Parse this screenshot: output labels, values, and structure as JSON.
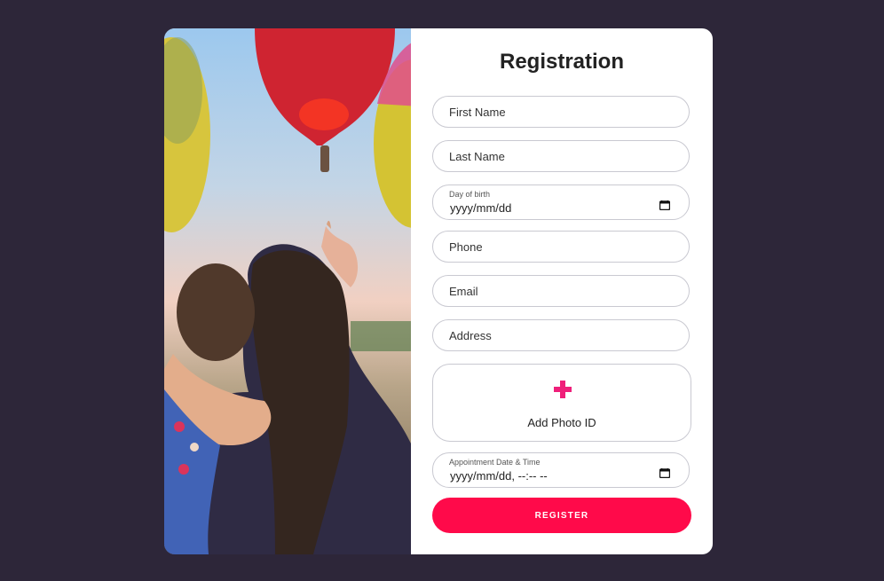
{
  "form": {
    "title": "Registration",
    "first_name_placeholder": "First Name",
    "last_name_placeholder": "Last Name",
    "dob_label": "Day of birth",
    "dob_value": "yyyy/mm/dd",
    "phone_placeholder": "Phone",
    "email_placeholder": "Email",
    "address_placeholder": "Address",
    "photo_id_label": "Add Photo ID",
    "appointment_label": "Appointment Date & Time",
    "appointment_value": "yyyy/mm/dd, --:-- --",
    "register_label": "REGISTER"
  },
  "icons": {
    "calendar": "calendar-icon",
    "plus": "plus-icon"
  },
  "colors": {
    "background": "#2d2639",
    "accent": "#ff0a4a",
    "plus": "#ef1f7a"
  }
}
